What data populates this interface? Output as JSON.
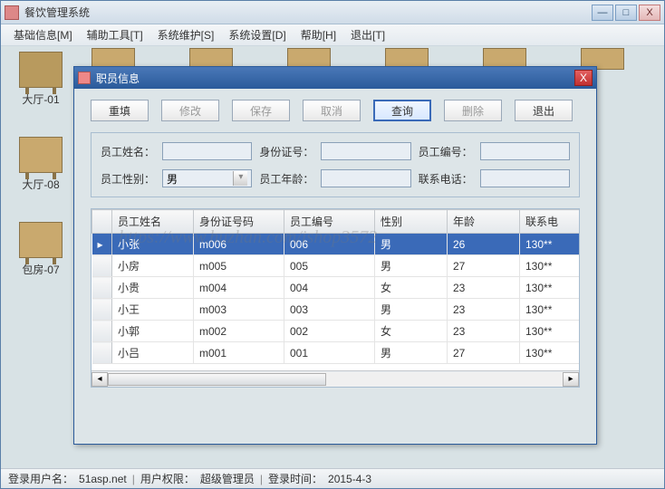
{
  "outer": {
    "title": "餐饮管理系统",
    "min": "—",
    "max": "□",
    "close": "X"
  },
  "menu": [
    "基础信息[M]",
    "辅助工具[T]",
    "系统维护[S]",
    "系统设置[D]",
    "帮助[H]",
    "退出[T]"
  ],
  "desks": [
    {
      "label": "大厅-01"
    },
    {
      "label": "大厅-08"
    },
    {
      "label": "包房-07"
    }
  ],
  "dialog": {
    "title": "职员信息",
    "close": "X",
    "buttons": {
      "refill": "重填",
      "modify": "修改",
      "save": "保存",
      "cancel": "取消",
      "query": "查询",
      "delete": "删除",
      "exit": "退出"
    },
    "form": {
      "name_label": "员工姓名：",
      "name_value": "",
      "id_label": "身份证号：",
      "id_value": "",
      "no_label": "员工编号：",
      "no_value": "",
      "gender_label": "员工性别：",
      "gender_value": "男",
      "age_label": "员工年龄：",
      "age_value": "",
      "phone_label": "联系电话：",
      "phone_value": ""
    },
    "grid": {
      "headers": [
        "员工姓名",
        "身份证号码",
        "员工编号",
        "性别",
        "年龄",
        "联系电"
      ],
      "rows": [
        {
          "selected": true,
          "cells": [
            "小张",
            "m006",
            "006",
            "男",
            "26",
            "130**"
          ]
        },
        {
          "selected": false,
          "cells": [
            "小房",
            "m005",
            "005",
            "男",
            "27",
            "130**"
          ]
        },
        {
          "selected": false,
          "cells": [
            "小贵",
            "m004",
            "004",
            "女",
            "23",
            "130**"
          ]
        },
        {
          "selected": false,
          "cells": [
            "小王",
            "m003",
            "003",
            "男",
            "23",
            "130**"
          ]
        },
        {
          "selected": false,
          "cells": [
            "小郭",
            "m002",
            "002",
            "女",
            "23",
            "130**"
          ]
        },
        {
          "selected": false,
          "cells": [
            "小吕",
            "m001",
            "001",
            "男",
            "27",
            "130**"
          ]
        }
      ]
    }
  },
  "status": {
    "user_label": "登录用户名：",
    "user": "51asp.net",
    "perm_label": "用户权限：",
    "perm": "超级管理员",
    "time_label": "登录时间：",
    "time": "2015-4-3"
  },
  "watermark": "https://www.huzhan.com/ishop3572"
}
